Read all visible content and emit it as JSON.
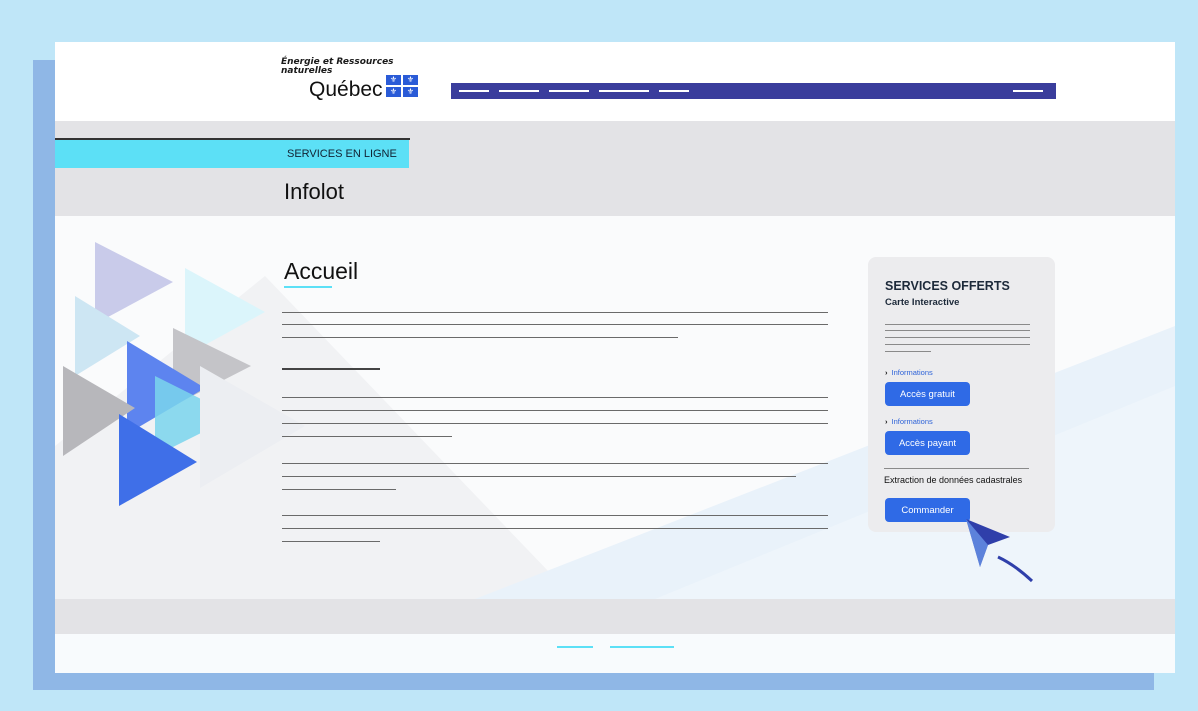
{
  "header": {
    "dept_line1": "Énergie et Ressources",
    "dept_line2": "naturelles",
    "gov_name": "Québec",
    "flag_symbol": "⚜"
  },
  "banner": {
    "services_tag": "SERVICES EN LIGNE",
    "app_title": "Infolot"
  },
  "main": {
    "heading": "Accueil"
  },
  "card": {
    "title": "SERVICES OFFERTS",
    "subtitle": "Carte Interactive",
    "info_arrow": "›",
    "info1": "Informations",
    "btn_free": "Accès gratuit",
    "info2": "Informations",
    "btn_paid": "Accès payant",
    "extraction_label": "Extraction de données cadastrales",
    "btn_order": "Commander"
  },
  "colors": {
    "accent_cyan": "#5ce0f6",
    "primary_button": "#2f6ae6",
    "nav_bar": "#3a3d9c"
  },
  "icons": [
    "fleur-de-lis-icon",
    "chevron-right-icon",
    "mouse-cursor-icon"
  ]
}
